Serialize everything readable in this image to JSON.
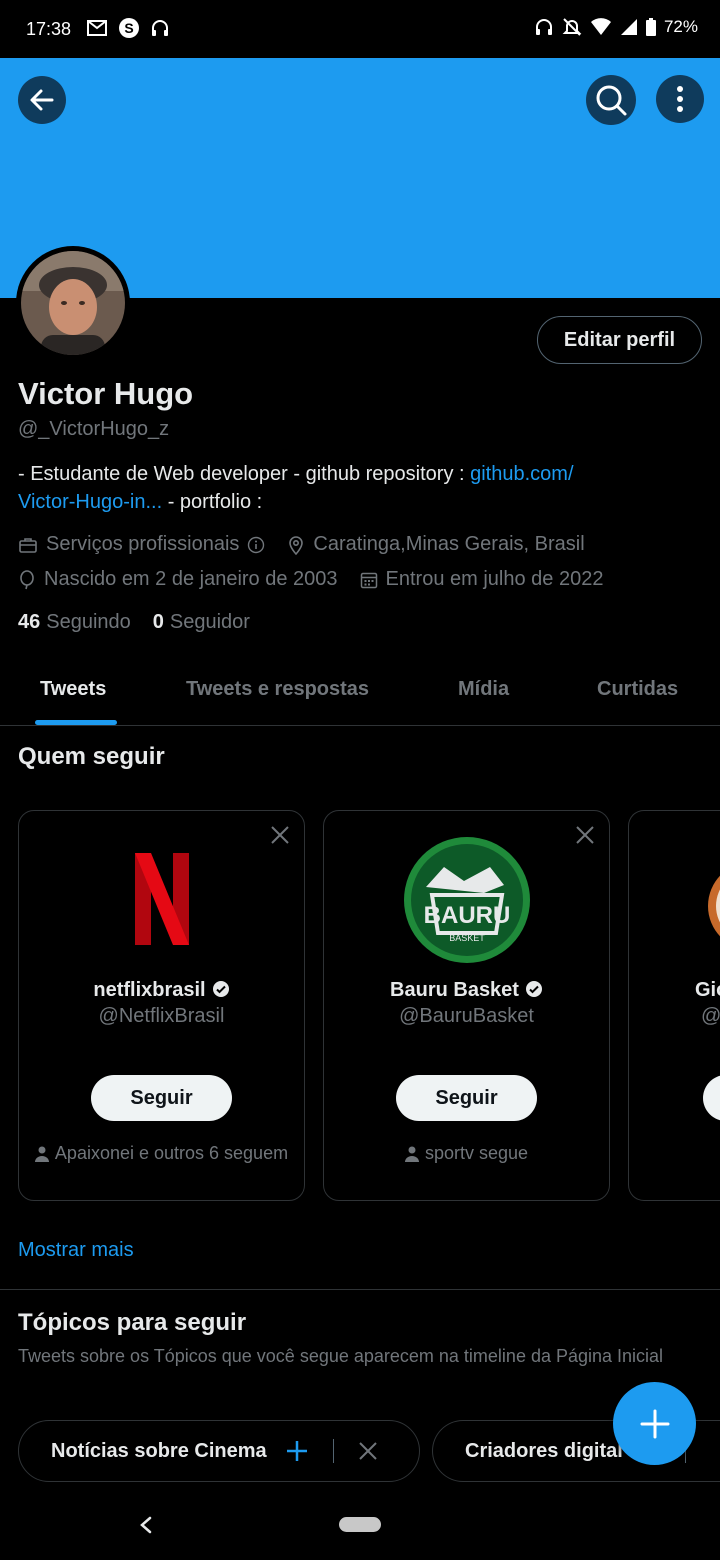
{
  "status_bar": {
    "time": "17:38",
    "battery": "72%"
  },
  "profile": {
    "edit_label": "Editar perfil",
    "name": "Victor Hugo",
    "handle": "@_VictorHugo_z",
    "bio_text_1": "- Estudante de Web developer - github repository : ",
    "bio_link_1": "github.com/",
    "bio_link_2": "Victor-Hugo-in...",
    "bio_text_2": " - portfolio :",
    "category": "Serviços profissionais",
    "location": "Caratinga,Minas Gerais, Brasil",
    "birthday": "Nascido em 2 de janeiro de 2003",
    "joined": "Entrou em julho de 2022",
    "following_count": "46",
    "following_label": "Seguindo",
    "followers_count": "0",
    "followers_label": "Seguidor"
  },
  "tabs": [
    {
      "label": "Tweets"
    },
    {
      "label": "Tweets e respostas"
    },
    {
      "label": "Mídia"
    },
    {
      "label": "Curtidas"
    }
  ],
  "who_to_follow": {
    "title": "Quem seguir",
    "cards": [
      {
        "name": "netflixbrasil",
        "handle": "@NetflixBrasil",
        "button": "Seguir",
        "social": "Apaixonei e outros 6 seguem"
      },
      {
        "name": "Bauru Basket",
        "handle": "@BauruBasket",
        "button": "Seguir",
        "social": "sportv segue"
      },
      {
        "name": "Gio",
        "handle": "@"
      }
    ],
    "show_more": "Mostrar mais"
  },
  "topics": {
    "title": "Tópicos para seguir",
    "subtitle": "Tweets sobre os Tópicos que você segue aparecem na timeline da Página Inicial",
    "chips": [
      {
        "label": "Notícias sobre Cinema"
      },
      {
        "label": "Criadores digital"
      }
    ]
  },
  "colors": {
    "accent": "#1d9bf0",
    "background": "#000000",
    "text": "#e7e9ea",
    "muted": "#71767b",
    "netflix_red": "#e50914",
    "bauru_green": "#1f8a3a"
  }
}
